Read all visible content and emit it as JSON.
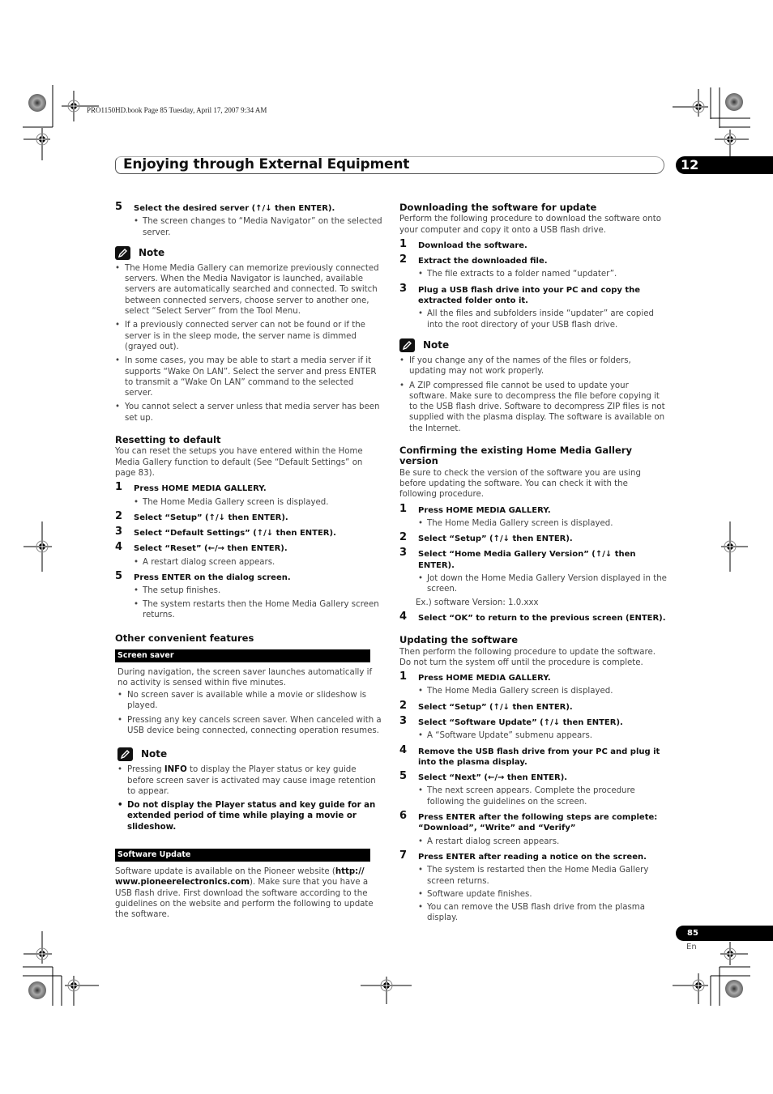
{
  "slug": "PRO1150HD.book  Page 85  Tuesday, April 17, 2007  9:34 AM",
  "header": {
    "title": "Enjoying through External Equipment",
    "chapter": "12"
  },
  "footer": {
    "page": "85",
    "lang": "En"
  },
  "left": {
    "step5": {
      "num": "5",
      "text": "Select the desired server (↑/↓ then ENTER).",
      "bullets": [
        "The screen changes to “Media Navigator” on the selected server."
      ]
    },
    "note1": {
      "label": "Note",
      "items": [
        "The Home Media Gallery can memorize previously connected servers. When the Media Navigator is launched, available servers are automatically searched and connected. To switch between connected servers, choose server to another one, select “Select Server” from the Tool Menu.",
        "If a previously connected server can not be found or if the server is in the sleep mode, the server name is dimmed (grayed out).",
        "In some cases, you may be able to start a media server if it supports “Wake On LAN”. Select the server and press ENTER to transmit a “Wake On LAN” command to the selected server.",
        "You cannot select a server unless that media server has been set up."
      ]
    },
    "reset": {
      "heading": "Resetting to default",
      "intro": "You can reset the setups you have entered within the Home Media Gallery function to default (See “Default Settings” on page 83).",
      "steps": [
        {
          "num": "1",
          "text": "Press HOME MEDIA GALLERY.",
          "bullets": [
            "The Home Media Gallery screen is displayed."
          ]
        },
        {
          "num": "2",
          "text": "Select “Setup” (↑/↓ then ENTER).",
          "bullets": []
        },
        {
          "num": "3",
          "text": "Select “Default Settings” (↑/↓ then ENTER).",
          "bullets": []
        },
        {
          "num": "4",
          "text": "Select “Reset” (←/→ then ENTER).",
          "bullets": [
            "A restart dialog screen appears."
          ]
        },
        {
          "num": "5",
          "text": "Press ENTER on the dialog screen.",
          "bullets": [
            "The setup finishes.",
            "The system restarts then the Home Media Gallery screen returns."
          ]
        }
      ]
    },
    "other": {
      "heading": "Other convenient features",
      "screensaver_bar": "Screen saver",
      "screensaver_intro": "During navigation, the screen saver launches automatically if no activity is sensed within five minutes.",
      "screensaver_bullets": [
        "No screen saver is available while a movie or slideshow is played.",
        "Pressing any key cancels screen saver. When canceled with a USB device being connected, connecting operation resumes."
      ],
      "note2_label": "Note",
      "note2_item1_pre": "Pressing ",
      "note2_item1_key": "INFO",
      "note2_item1_post": " to display the Player status or key guide before screen saver is activated may cause image retention to appear.",
      "note2_item2": "Do not display the Player status and key guide for an extended period of time while playing a movie or slideshow.",
      "swupdate_bar": "Software Update",
      "swupdate_pre": "Software update is available on the Pioneer website (",
      "swupdate_url": "http:// www.pioneerelectronics.com",
      "swupdate_post": ").  Make sure that you have a USB flash drive. First download the software according to the guidelines on the website and perform the following to update the software."
    }
  },
  "right": {
    "download": {
      "heading": "Downloading the software for update",
      "intro": "Perform the following procedure to download the software onto your computer and copy it onto a USB flash drive.",
      "steps": [
        {
          "num": "1",
          "text": "Download the software.",
          "bullets": []
        },
        {
          "num": "2",
          "text": "Extract the downloaded file.",
          "bullets": [
            "The file extracts to a folder named “updater”."
          ]
        },
        {
          "num": "3",
          "text": "Plug a USB flash drive into your PC and copy the extracted folder onto it.",
          "bullets": [
            "All the files and subfolders inside “updater” are copied into the root directory of your USB flash drive."
          ]
        }
      ]
    },
    "note3": {
      "label": "Note",
      "items": [
        "If you change any of the names of the files or folders, updating may not work properly.",
        "A ZIP compressed file cannot be used to update your software. Make sure to decompress the file before copying it to the USB flash drive. Software to decompress ZIP files is not supplied with the plasma display. The software is available on the Internet."
      ]
    },
    "confirm": {
      "heading": "Confirming the existing Home Media Gallery version",
      "intro": "Be sure to check the version of the software you are using before updating the software. You can check it with the following procedure.",
      "steps": [
        {
          "num": "1",
          "text": "Press HOME MEDIA GALLERY.",
          "bullets": [
            "The Home Media Gallery screen is displayed."
          ]
        },
        {
          "num": "2",
          "text": "Select “Setup” (↑/↓ then ENTER).",
          "bullets": []
        },
        {
          "num": "3",
          "text": "Select “Home Media Gallery Version” (↑/↓ then ENTER).",
          "bullets": [
            "Jot down the Home Media Gallery Version displayed in the screen."
          ]
        }
      ],
      "example": "Ex.) software Version: 1.0.xxx",
      "step4": {
        "num": "4",
        "text": "Select “OK” to return to the previous screen (ENTER)."
      }
    },
    "update": {
      "heading": "Updating the software",
      "intro": "Then perform the following procedure to update the software. Do not turn the system off until the procedure is complete.",
      "steps": [
        {
          "num": "1",
          "text": "Press HOME MEDIA GALLERY.",
          "bullets": [
            "The Home Media Gallery screen is displayed."
          ]
        },
        {
          "num": "2",
          "text": "Select “Setup” (↑/↓ then ENTER).",
          "bullets": []
        },
        {
          "num": "3",
          "text": "Select “Software Update” (↑/↓ then ENTER).",
          "bullets": [
            "A “Software Update” submenu appears."
          ]
        },
        {
          "num": "4",
          "text": "Remove the USB flash drive from your PC and plug it into the plasma display.",
          "bullets": []
        },
        {
          "num": "5",
          "text": "Select “Next” (←/→ then ENTER).",
          "bullets": [
            "The next screen appears. Complete the procedure following the guidelines on the screen."
          ]
        },
        {
          "num": "6",
          "text": "Press ENTER after the following steps are complete: “Download”, “Write” and “Verify”",
          "bullets": [
            "A restart dialog screen appears."
          ]
        },
        {
          "num": "7",
          "text": "Press ENTER after reading a notice on the screen.",
          "bullets": [
            "The system is restarted then the Home Media Gallery screen returns.",
            "Software update finishes.",
            "You can remove the USB flash drive from the plasma display."
          ]
        }
      ]
    }
  }
}
